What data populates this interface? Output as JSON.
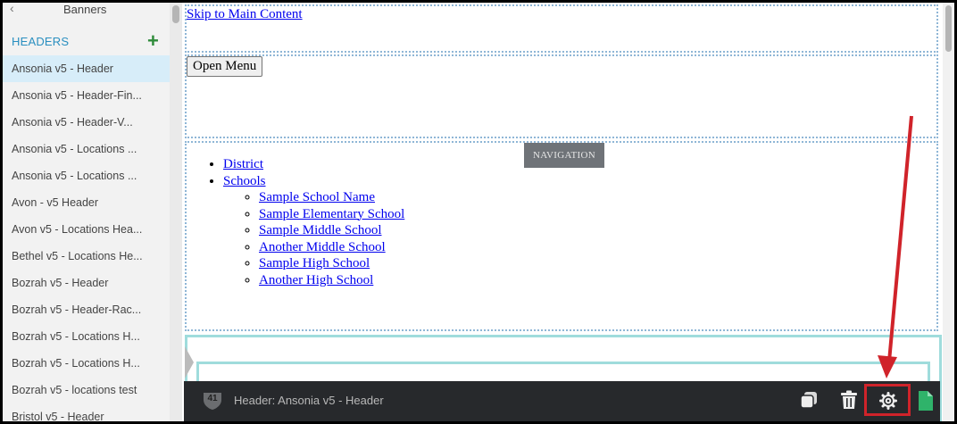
{
  "sidebar": {
    "back_icon": "chevron-left-icon",
    "banners_label": "Banners",
    "section_label": "HEADERS",
    "add_icon": "plus-icon",
    "items": [
      {
        "label": "Ansonia v5 - Header",
        "active": true
      },
      {
        "label": "Ansonia v5 - Header-Fin..."
      },
      {
        "label": "Ansonia v5 - Header-V..."
      },
      {
        "label": "Ansonia v5 - Locations ..."
      },
      {
        "label": "Ansonia v5 - Locations ..."
      },
      {
        "label": "Avon - v5 Header"
      },
      {
        "label": "Avon v5 - Locations Hea..."
      },
      {
        "label": "Bethel v5 - Locations He..."
      },
      {
        "label": "Bozrah v5 - Header"
      },
      {
        "label": "Bozrah v5 - Header-Rac..."
      },
      {
        "label": "Bozrah v5 - Locations H..."
      },
      {
        "label": "Bozrah v5 - Locations H..."
      },
      {
        "label": "Bozrah v5 - locations test"
      },
      {
        "label": "Bristol v5 - Header"
      }
    ]
  },
  "main": {
    "skip_link": "Skip to Main Content",
    "open_menu_button": "Open Menu",
    "navigation_tag": "NAVIGATION",
    "nav_items": [
      "District",
      "Schools"
    ],
    "school_items": [
      "Sample School Name",
      "Sample Elementary School",
      "Sample Middle School",
      "Another Middle School",
      "Sample High School",
      "Another High School"
    ]
  },
  "toolbar": {
    "badge_count": "41",
    "title": "Header: Ansonia v5 - Header",
    "icons": [
      "copy-icon",
      "trash-icon",
      "gear-icon",
      "page-icon"
    ]
  },
  "colors": {
    "accent_blue": "#2a8fc0",
    "add_green": "#2e8b3a",
    "toolbar_bg": "#27292c",
    "annotation_red": "#d0232a",
    "teal_outline": "#9fdcdc"
  }
}
